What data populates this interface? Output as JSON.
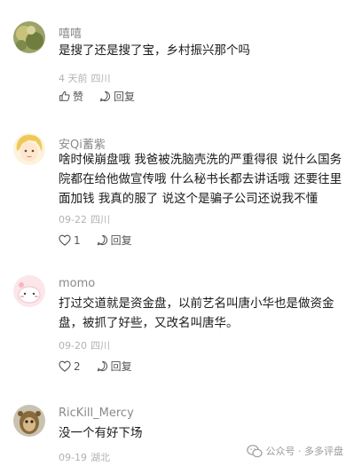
{
  "comments": [
    {
      "name": "嘻嘻",
      "lines": [
        "是搜了还是搜了宝，乡村振兴那个吗"
      ],
      "time": "4 天前",
      "location": "四川",
      "like_label": "赞",
      "like_count": "",
      "reply_label": "回复"
    },
    {
      "name": "安Qi蓄紫",
      "lines": [
        "啥时候崩盘哦 我爸被洗脑壳洗的严重得很 说什么国务",
        "院都在给他做宣传哦 什么秘书长都去讲话哦 还要往里",
        "面加钱 我真的服了 说这个是骗子公司还说我不懂"
      ],
      "time": "09-22",
      "location": "四川",
      "like_label": "",
      "like_count": "1",
      "reply_label": "回复"
    },
    {
      "name": "momo",
      "lines": [
        "打过交道就是资金盘，以前艺名叫唐小华也是做资金",
        "盘，被抓了好些，又改名叫唐华。"
      ],
      "time": "09-20",
      "location": "四川",
      "like_label": "",
      "like_count": "2",
      "reply_label": "回复"
    },
    {
      "name": "RicKill_Mercy",
      "lines": [
        "没一个有好下场"
      ],
      "time": "09-19",
      "location": "湖北",
      "like_label": "",
      "like_count": "",
      "reply_label": ""
    }
  ],
  "watermark": "公众号 · 多多评盘",
  "icons": {
    "like": "thumb-up-icon",
    "reply": "reply-bubble-icon",
    "watermark": "wechat-icon"
  }
}
